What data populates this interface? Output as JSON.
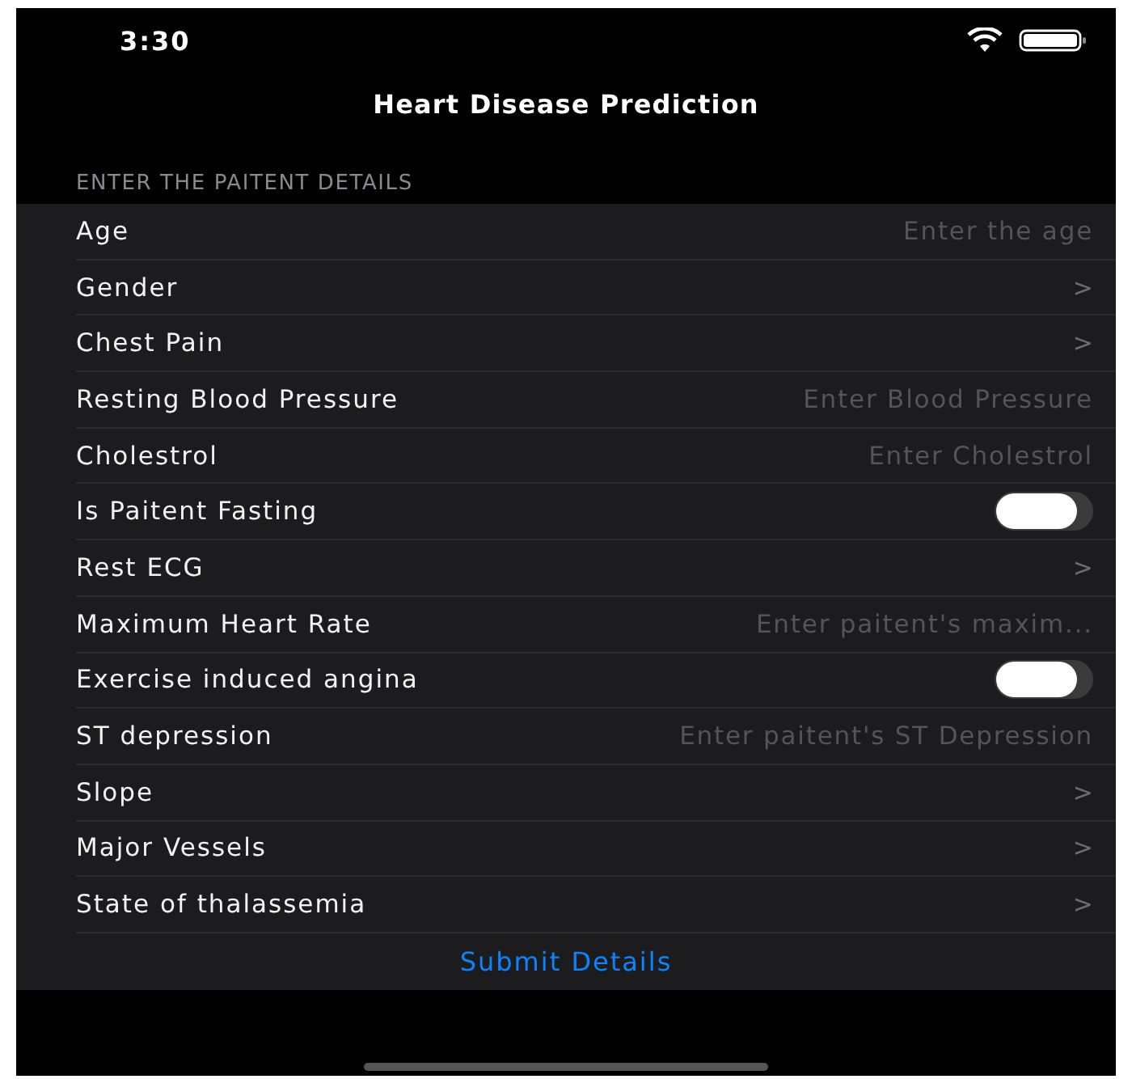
{
  "status_bar": {
    "time": "3:30"
  },
  "nav": {
    "title": "Heart Disease Prediction"
  },
  "section": {
    "header": "ENTER THE PAITENT DETAILS"
  },
  "rows": [
    {
      "kind": "input",
      "label": "Age",
      "placeholder": "Enter the age"
    },
    {
      "kind": "picker",
      "label": "Gender",
      "chevron": ">"
    },
    {
      "kind": "picker",
      "label": "Chest Pain",
      "chevron": ">"
    },
    {
      "kind": "input",
      "label": "Resting Blood Pressure",
      "placeholder": "Enter Blood Pressure"
    },
    {
      "kind": "input",
      "label": "Cholestrol",
      "placeholder": "Enter Cholestrol"
    },
    {
      "kind": "toggle",
      "label": "Is Paitent Fasting",
      "on": false
    },
    {
      "kind": "picker",
      "label": "Rest ECG",
      "chevron": ">"
    },
    {
      "kind": "input",
      "label": "Maximum Heart Rate",
      "placeholder": "Enter paitent's maxim..."
    },
    {
      "kind": "toggle",
      "label": "Exercise induced angina",
      "on": false
    },
    {
      "kind": "input",
      "label": "ST depression",
      "placeholder": "Enter paitent's ST Depression"
    },
    {
      "kind": "picker",
      "label": "Slope",
      "chevron": ">"
    },
    {
      "kind": "picker",
      "label": "Major Vessels",
      "chevron": ">"
    },
    {
      "kind": "picker",
      "label": "State of thalassemia",
      "chevron": ">"
    }
  ],
  "submit": {
    "label": "Submit Details"
  }
}
